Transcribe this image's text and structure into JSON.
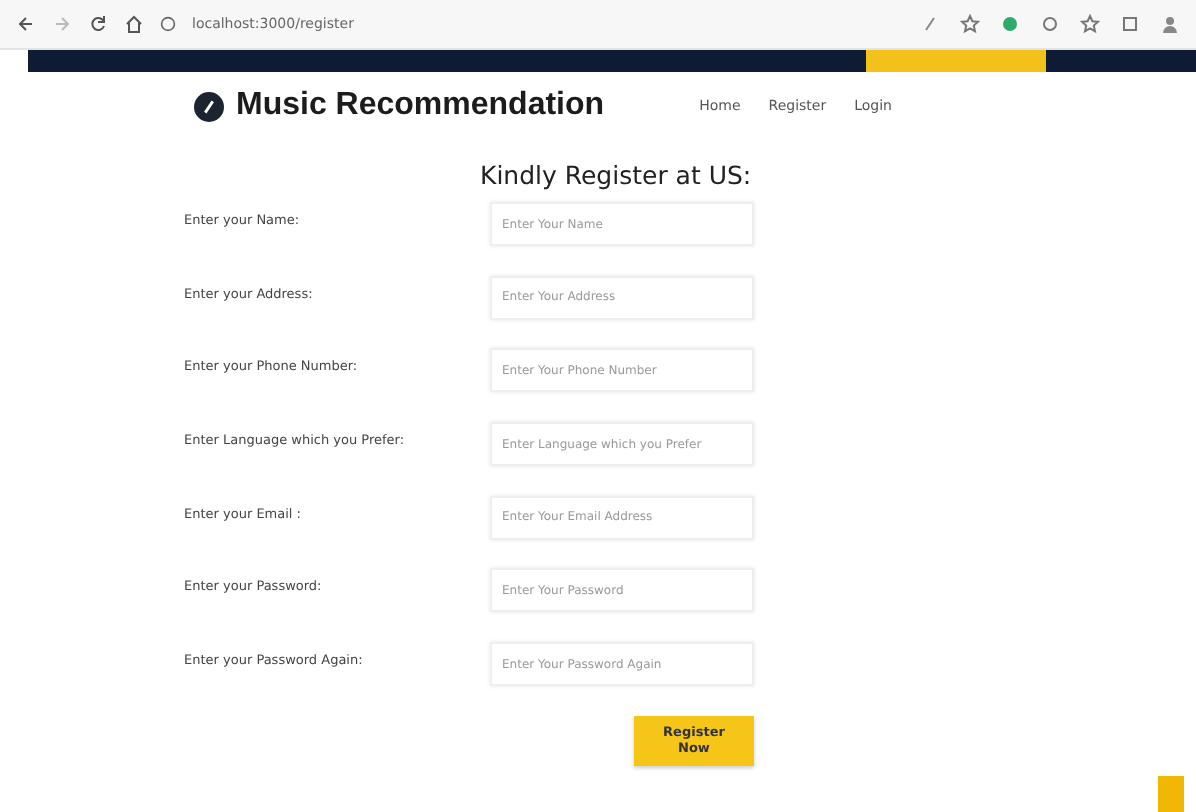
{
  "browser": {
    "url": "localhost:3000/register"
  },
  "navbar": {
    "brand": "Music Recommendation",
    "links": [
      "Home",
      "Register",
      "Login"
    ]
  },
  "form": {
    "heading": "Kindly Register at US:",
    "fields": [
      {
        "label": "Enter your Name:",
        "placeholder": "Enter Your Name"
      },
      {
        "label": "Enter your Address:",
        "placeholder": "Enter Your Address"
      },
      {
        "label": "Enter your Phone Number:",
        "placeholder": "Enter Your Phone Number"
      },
      {
        "label": "Enter Language which you Prefer:",
        "placeholder": "Enter Language which you Prefer"
      },
      {
        "label": "Enter your Email :",
        "placeholder": "Enter Your Email Address"
      },
      {
        "label": "Enter your Password:",
        "placeholder": "Enter Your Password"
      },
      {
        "label": "Enter your Password Again:",
        "placeholder": "Enter Your Password Again"
      }
    ],
    "submit": "Register Now"
  }
}
